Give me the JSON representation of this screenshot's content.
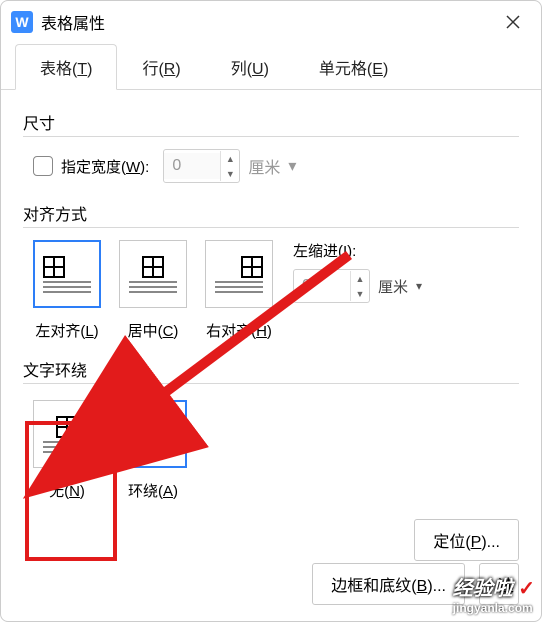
{
  "titlebar": {
    "icon": "W",
    "title": "表格属性"
  },
  "tabs": [
    {
      "label": "表格(T)",
      "accel": "T"
    },
    {
      "label": "行(R)",
      "accel": "R"
    },
    {
      "label": "列(U)",
      "accel": "U"
    },
    {
      "label": "单元格(E)",
      "accel": "E"
    }
  ],
  "size": {
    "section": "尺寸",
    "widthLabel": "指定宽度(W):",
    "widthAccel": "W",
    "value": "0",
    "unit": "厘米"
  },
  "alignment": {
    "section": "对齐方式",
    "options": [
      {
        "label": "左对齐(L)",
        "accel": "L"
      },
      {
        "label": "居中(C)",
        "accel": "C"
      },
      {
        "label": "右对齐(H)",
        "accel": "H"
      }
    ],
    "indentLabel": "左缩进(I):",
    "indentAccel": "I",
    "indentValue": "0",
    "indentUnit": "厘米"
  },
  "wrap": {
    "section": "文字环绕",
    "options": [
      {
        "label": "无(N)",
        "accel": "N"
      },
      {
        "label": "环绕(A)",
        "accel": "A"
      }
    ],
    "positionBtn": "定位(P)..."
  },
  "buttons": {
    "borders": "边框和底纹(B)...",
    "options": "选"
  },
  "watermark": {
    "main": "经验啦",
    "sub": "jingyanla.com"
  }
}
